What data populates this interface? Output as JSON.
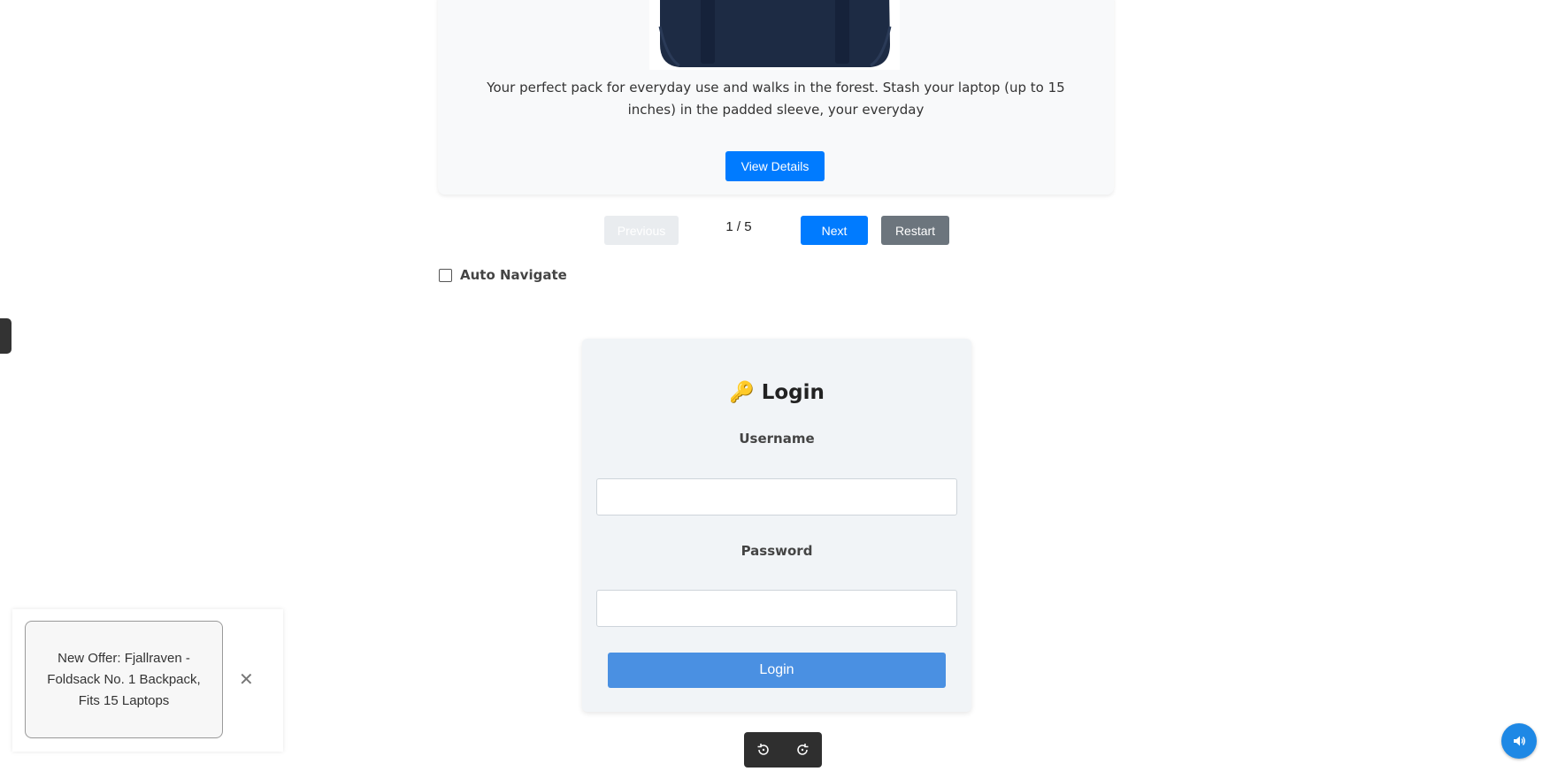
{
  "product": {
    "image_alt": "navy backpack",
    "description": "Your perfect pack for everyday use and walks in the forest. Stash your laptop (up to 15 inches) in the padded sleeve, your everyday",
    "view_details_label": "View Details"
  },
  "pager": {
    "previous_label": "Previous",
    "page_indicator": "1 / 5",
    "next_label": "Next",
    "restart_label": "Restart"
  },
  "auto_navigate": {
    "label": "Auto Navigate",
    "checked": false
  },
  "login": {
    "title": "🔑 Login",
    "username_label": "Username",
    "username_value": "",
    "password_label": "Password",
    "password_value": "",
    "submit_label": "Login"
  },
  "media": {
    "rewind_icon": "rewind-icon",
    "forward_icon": "forward-icon"
  },
  "offer": {
    "text": "New Offer: Fjallraven - Foldsack No. 1 Backpack, Fits 15 Laptops",
    "close_glyph": "✕"
  },
  "audio": {
    "icon": "speaker-icon"
  },
  "colors": {
    "primary": "#007bff",
    "secondary": "#6c757d",
    "login_button": "#4a90e2",
    "audio_button": "#1e88e5",
    "backpack": "#1d2b44"
  }
}
